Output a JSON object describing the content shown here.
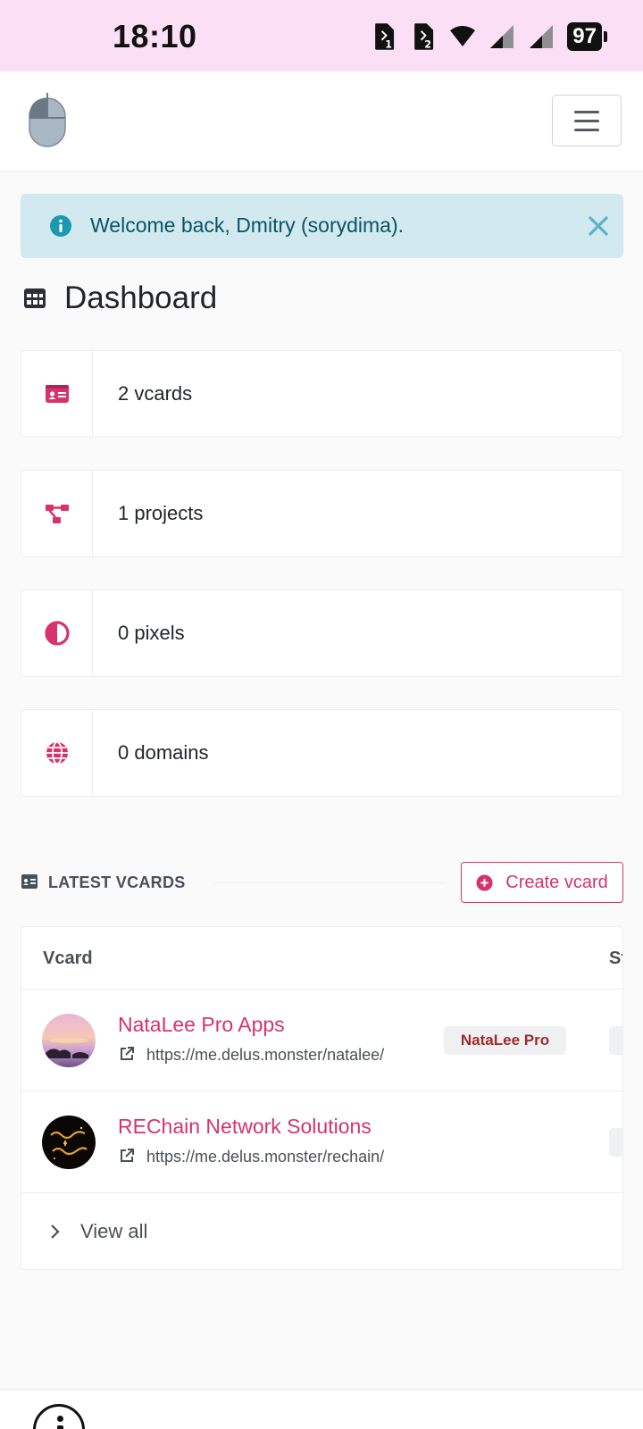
{
  "status_bar": {
    "time": "18:10",
    "battery": "97",
    "icons": [
      "sim1-icon",
      "sim2-icon",
      "wifi-icon",
      "signal-icon",
      "signal-icon",
      "battery-icon"
    ]
  },
  "header": {
    "logo_icon": "mouse-logo-icon",
    "menu_icon": "hamburger-icon"
  },
  "alert": {
    "text": "Welcome back, Dmitry (sorydima).",
    "icon": "info-circle-icon",
    "close_icon": "close-icon"
  },
  "dashboard": {
    "title": "Dashboard",
    "icon": "table-grid-icon",
    "stats": [
      {
        "label": "2 vcards",
        "icon": "id-card-icon"
      },
      {
        "label": "1 projects",
        "icon": "project-diagram-icon"
      },
      {
        "label": "0 pixels",
        "icon": "adjust-icon"
      },
      {
        "label": "0 domains",
        "icon": "globe-icon"
      }
    ]
  },
  "latest_vcards": {
    "title": "LATEST VCARDS",
    "create_label": "Create vcard",
    "columns": [
      "Vcard",
      "St"
    ],
    "rows": [
      {
        "name": "NataLee Pro Apps",
        "url": "https://me.delus.monster/natalee/",
        "badge": "NataLee Pro"
      },
      {
        "name": "REChain Network Solutions",
        "url": "https://me.delus.monster/rechain/",
        "badge": ""
      }
    ],
    "view_all_label": "View all"
  },
  "colors": {
    "accent": "#d6336c",
    "alert_bg": "#d1e9ef",
    "alert_text": "#0b5465",
    "status_bar_bg": "#fbe0f5"
  }
}
